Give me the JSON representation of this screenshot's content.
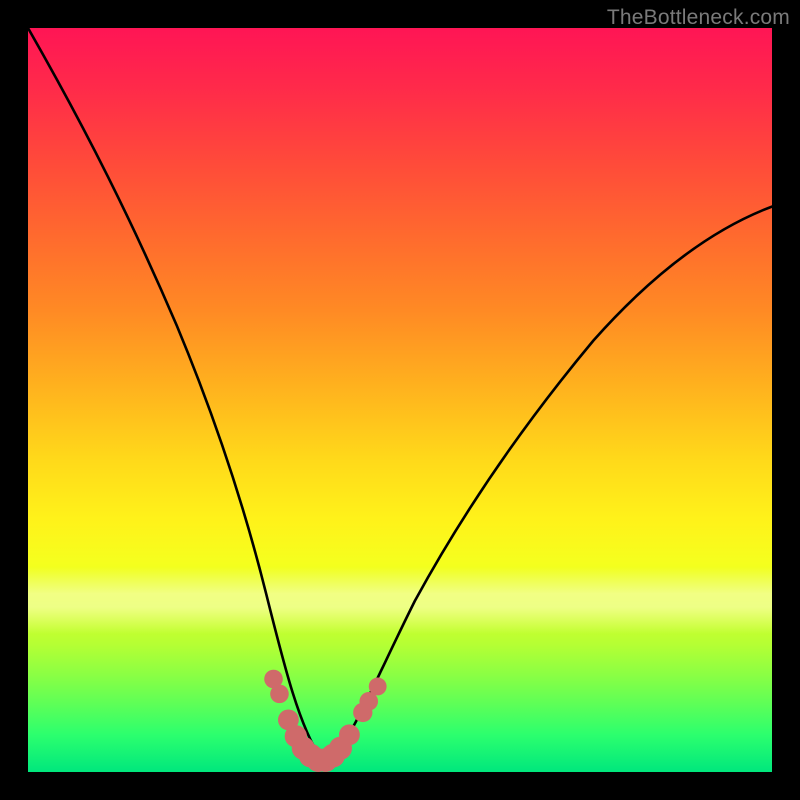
{
  "watermark": {
    "text": "TheBottleneck.com"
  },
  "chart_data": {
    "type": "line",
    "title": "",
    "xlabel": "",
    "ylabel": "",
    "xlim": [
      0,
      100
    ],
    "ylim": [
      0,
      100
    ],
    "grid": false,
    "legend": false,
    "series": [
      {
        "name": "bottleneck-curve",
        "x": [
          0,
          3,
          6,
          9,
          12,
          15,
          18,
          21,
          24,
          27,
          30,
          32,
          34,
          36,
          37,
          38,
          39,
          40,
          41,
          42,
          44,
          47,
          50,
          54,
          58,
          63,
          69,
          76,
          84,
          92,
          100
        ],
        "y": [
          100,
          92,
          84,
          76,
          68,
          60,
          52,
          44,
          36,
          28,
          20,
          14,
          9,
          5,
          3,
          2,
          1.5,
          1.5,
          2,
          3,
          6,
          11,
          16,
          22,
          28,
          35,
          42,
          50,
          58,
          66,
          74
        ]
      }
    ],
    "annotations": [
      {
        "name": "highlight-dots",
        "type": "points",
        "color": "#cf6a6a",
        "points": [
          {
            "x": 33.0,
            "y": 12.5
          },
          {
            "x": 33.8,
            "y": 10.5
          },
          {
            "x": 35.0,
            "y": 7.0
          },
          {
            "x": 36.0,
            "y": 4.8
          },
          {
            "x": 37.0,
            "y": 3.2
          },
          {
            "x": 38.0,
            "y": 2.2
          },
          {
            "x": 39.0,
            "y": 1.6
          },
          {
            "x": 40.0,
            "y": 1.6
          },
          {
            "x": 41.0,
            "y": 2.2
          },
          {
            "x": 42.0,
            "y": 3.2
          },
          {
            "x": 43.2,
            "y": 5.0
          },
          {
            "x": 45.0,
            "y": 8.0
          },
          {
            "x": 45.8,
            "y": 9.5
          },
          {
            "x": 47.0,
            "y": 11.5
          }
        ]
      }
    ],
    "background": {
      "type": "vertical-gradient",
      "stops": [
        {
          "pos": 0,
          "color": "#ff1555"
        },
        {
          "pos": 50,
          "color": "#ffb11e"
        },
        {
          "pos": 70,
          "color": "#fff21a"
        },
        {
          "pos": 100,
          "color": "#00e77d"
        }
      ]
    }
  }
}
